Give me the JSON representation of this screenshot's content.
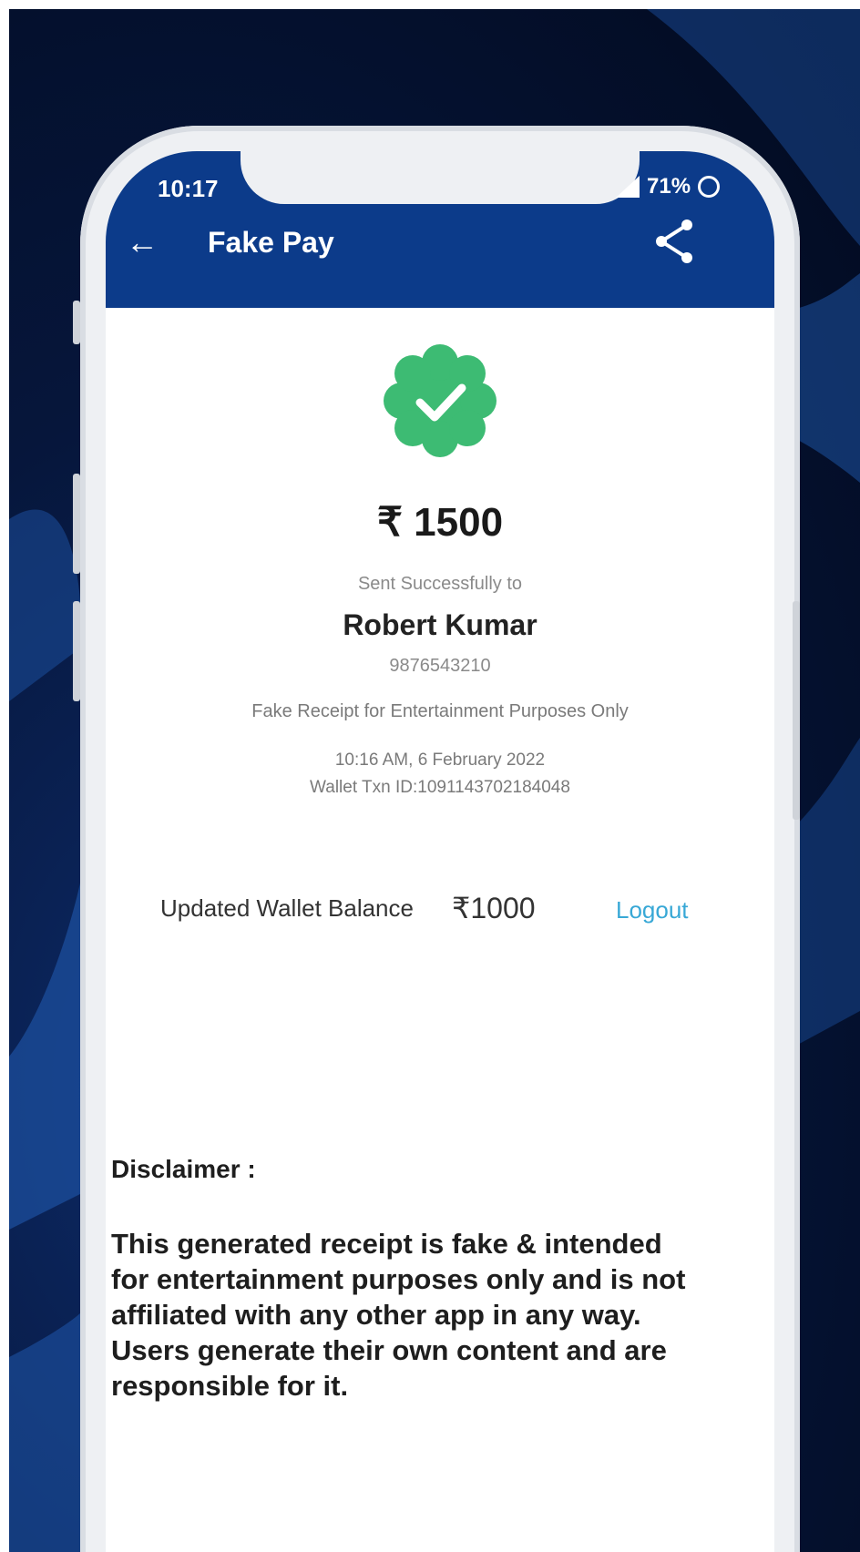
{
  "status_bar": {
    "time": "10:17",
    "battery": "71%"
  },
  "header": {
    "title": "Fake Pay",
    "back_icon": "arrow-left-icon",
    "share_icon": "share-icon"
  },
  "receipt": {
    "badge_icon": "verified-check-badge-icon",
    "amount": "₹ 1500",
    "sent_label": "Sent Successfully to",
    "recipient_name": "Robert Kumar",
    "recipient_phone": "9876543210",
    "note": "Fake Receipt for Entertainment Purposes Only",
    "datetime": "10:16 AM, 6 February 2022",
    "txn_id": "Wallet Txn ID:1091143702184048"
  },
  "balance": {
    "label": "Updated Wallet Balance",
    "value": "₹1000",
    "logout_label": "Logout"
  },
  "disclaimer": {
    "title": "Disclaimer :",
    "text": "This generated receipt is fake & intended for entertainment purposes only and is not affiliated with any other app in any way. Users generate their own content and are responsible for it."
  },
  "colors": {
    "header_blue": "#0c3b8a",
    "success_green": "#3dbb73",
    "link_blue": "#38a8d6"
  }
}
